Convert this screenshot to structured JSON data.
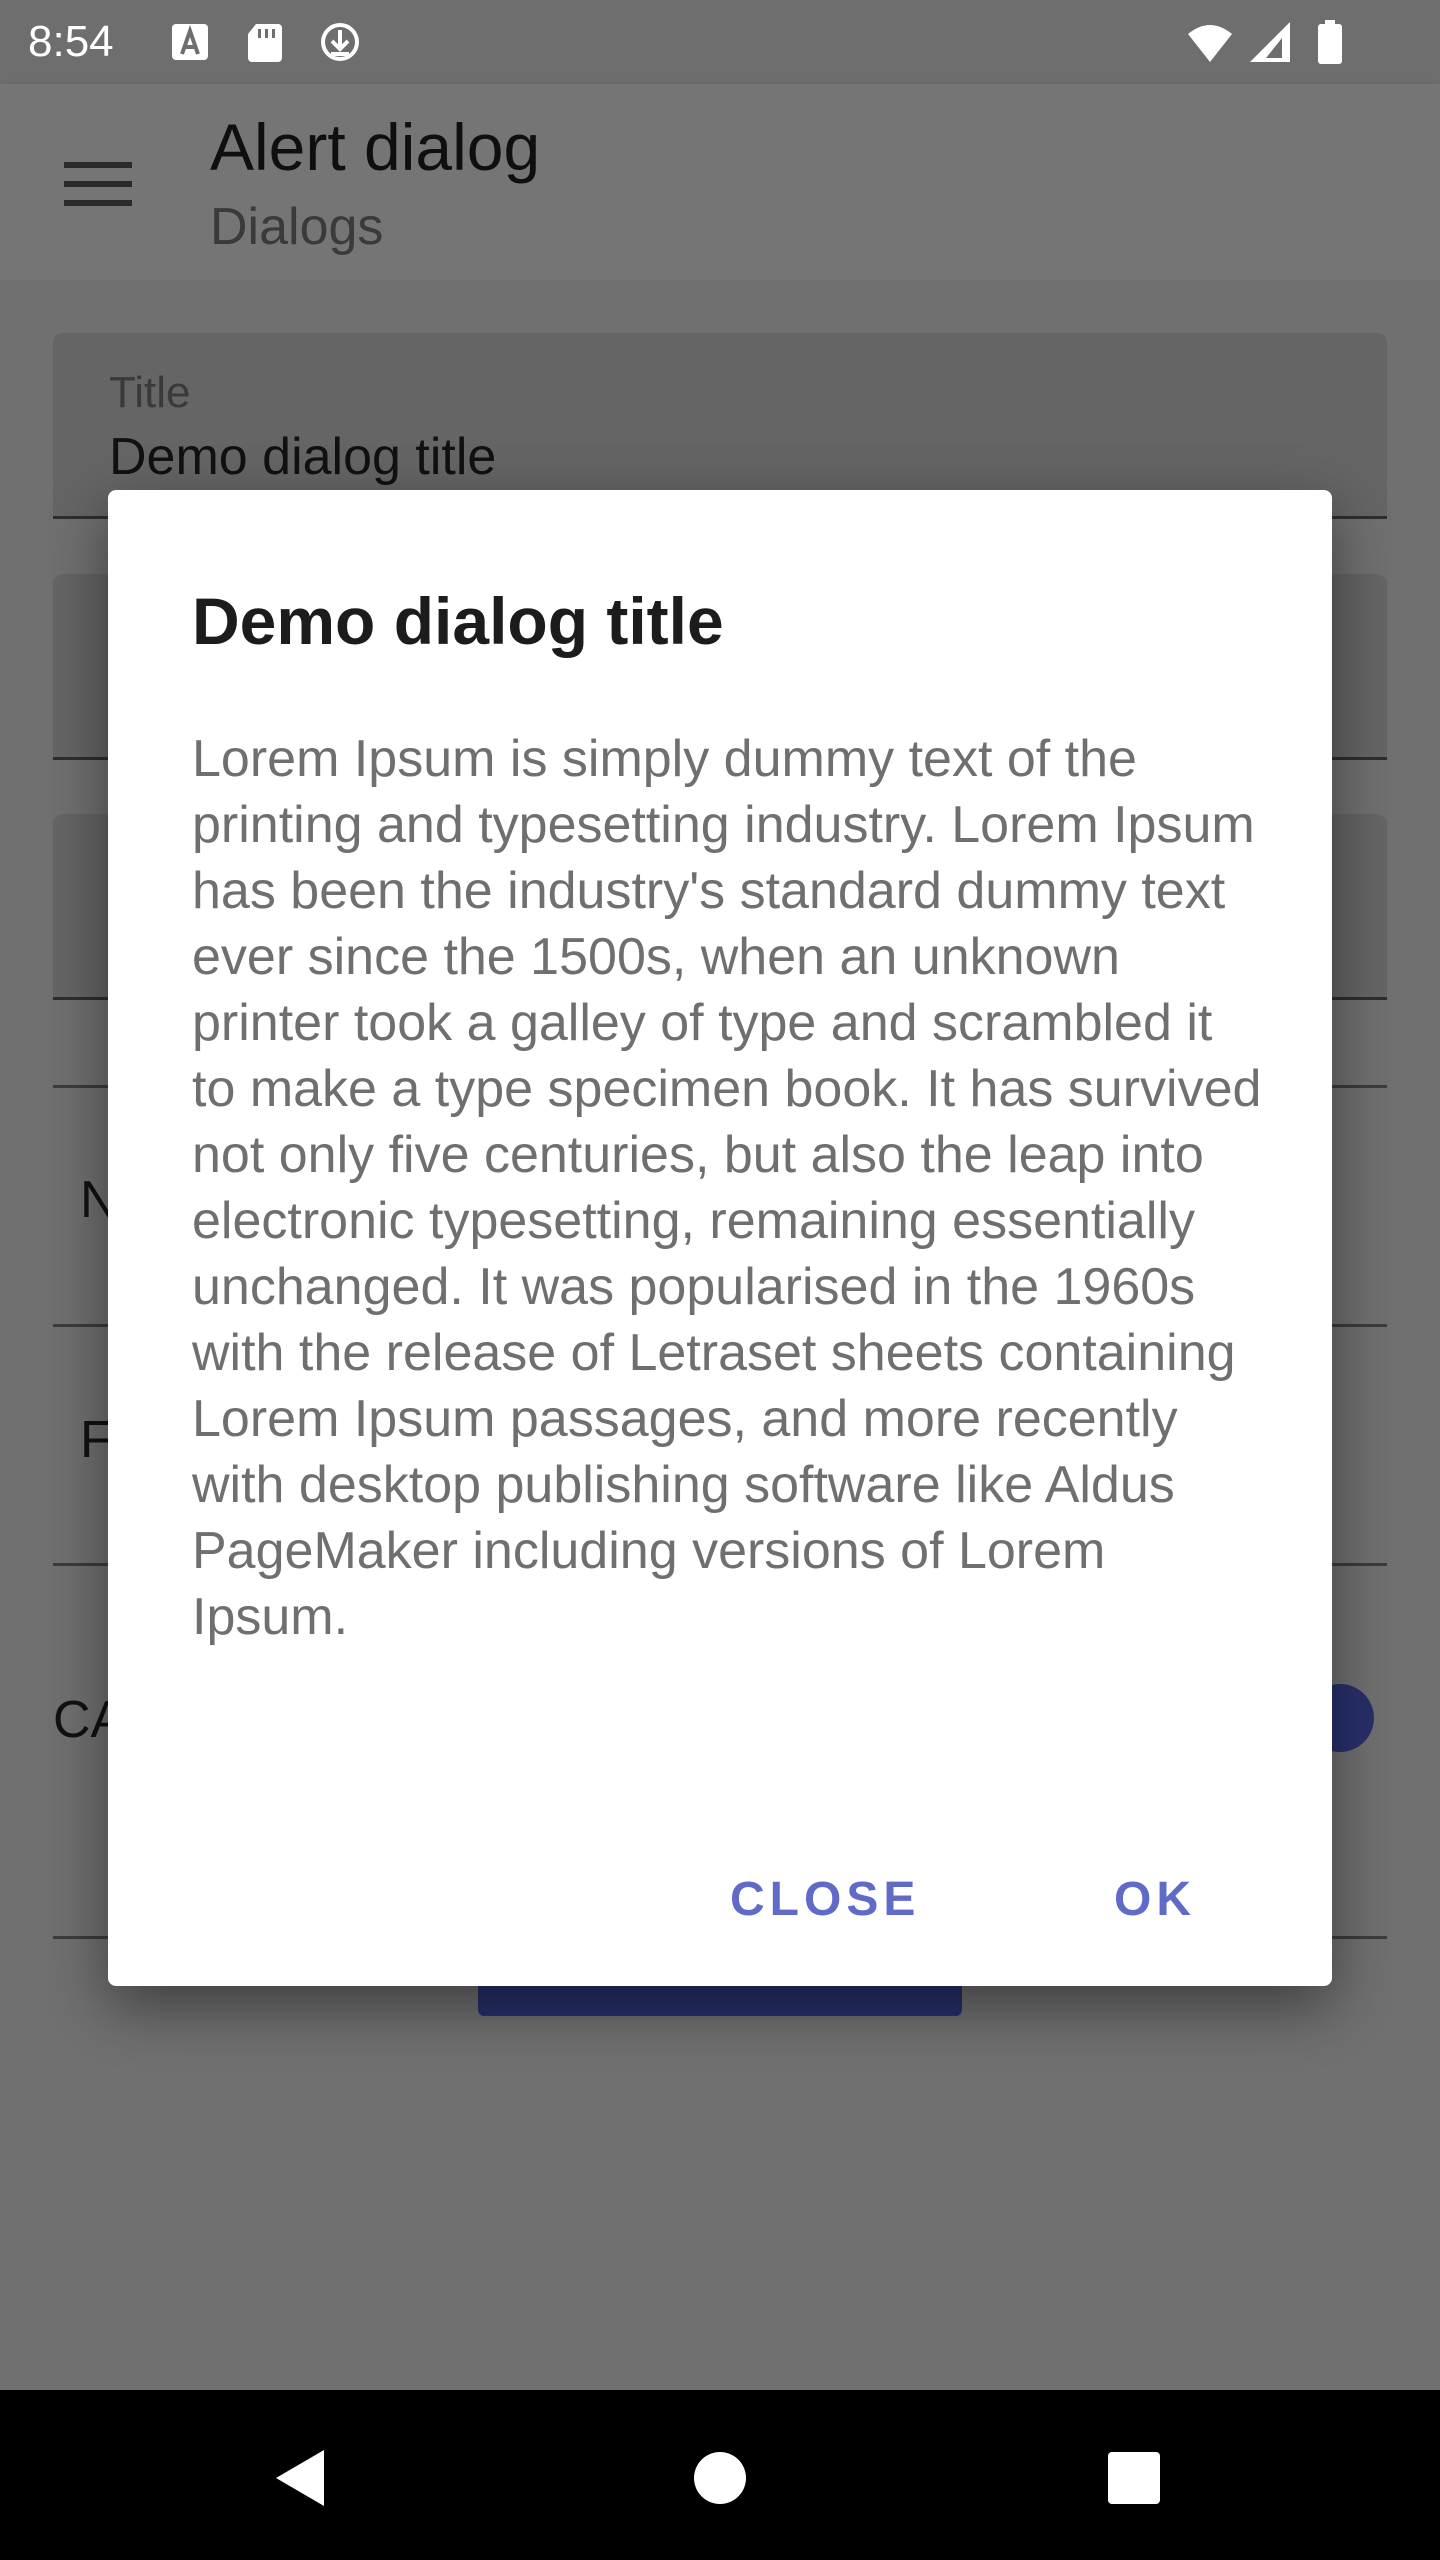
{
  "status_bar": {
    "time": "8:54",
    "icons": [
      "a-notification-icon",
      "sd-card-icon",
      "download-icon",
      "wifi-icon",
      "cellular-signal-icon",
      "battery-icon"
    ]
  },
  "app_bar": {
    "title": "Alert dialog",
    "subtitle": "Dialogs"
  },
  "form": {
    "title_field": {
      "label": "Title",
      "value": "Demo dialog title"
    },
    "row_letters": [
      "N",
      "F",
      "CA"
    ]
  },
  "dialog": {
    "title": "Demo dialog title",
    "message": "Lorem Ipsum is simply dummy text of the printing and typesetting industry. Lorem Ipsum has been the industry's standard dummy text ever since the 1500s, when an unknown printer took a galley of type and scrambled it to make a type specimen book. It has survived not only five centuries, but also the leap into electronic typesetting, remaining essentially unchanged. It was popularised in the 1960s with the release of Letraset sheets containing Lorem Ipsum passages, and more recently with desktop publishing software like Aldus PageMaker including versions of Lorem Ipsum.",
    "buttons": {
      "close": "CLOSE",
      "ok": "OK"
    }
  },
  "colors": {
    "accent": "#5f6bc6",
    "primary_dimmed": "#28306b",
    "scrim": "#707070"
  }
}
